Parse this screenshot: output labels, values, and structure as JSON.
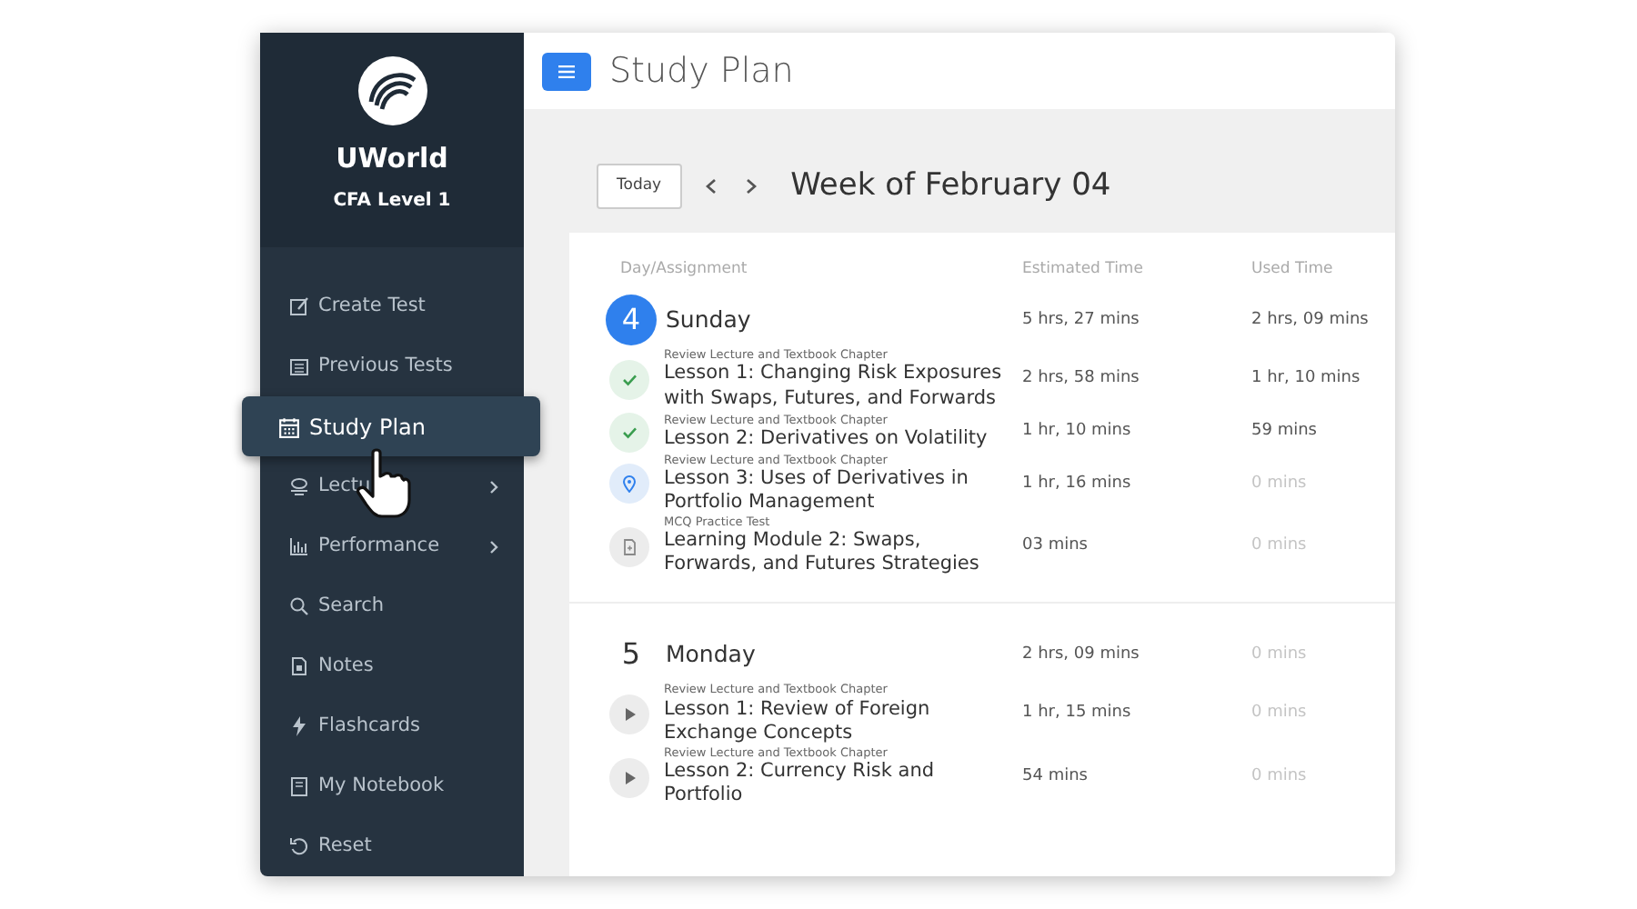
{
  "sidebar": {
    "brand": "UWorld",
    "subtitle": "CFA Level 1",
    "items": [
      {
        "label": "Create Test",
        "selected": false,
        "submenu": false
      },
      {
        "label": "Previous Tests",
        "selected": false,
        "submenu": false
      },
      {
        "label": "Study Plan",
        "selected": true,
        "submenu": false
      },
      {
        "label": "Lectu",
        "selected": false,
        "submenu": true
      },
      {
        "label": "Performance",
        "selected": false,
        "submenu": true
      },
      {
        "label": "Search",
        "selected": false,
        "submenu": false
      },
      {
        "label": "Notes",
        "selected": false,
        "submenu": false
      },
      {
        "label": "Flashcards",
        "selected": false,
        "submenu": false
      },
      {
        "label": "My Notebook",
        "selected": false,
        "submenu": false
      },
      {
        "label": "Reset",
        "selected": false,
        "submenu": false
      }
    ]
  },
  "header": {
    "title": "Study Plan"
  },
  "toolbar": {
    "today_button": "Today",
    "week_title": "Week of February 04"
  },
  "table": {
    "columns": [
      "Day/Assignment",
      "Estimated Time",
      "Used Time"
    ],
    "days": [
      {
        "number": "4",
        "name": "Sunday",
        "today": true,
        "estimated": "5 hrs, 27 mins",
        "used": "2 hrs, 09 mins",
        "started": true,
        "assignments": [
          {
            "kind": "done",
            "category": "Review Lecture and Textbook Chapter",
            "title": "Lesson 1: Changing Risk Exposures with Swaps, Futures, and Forwards",
            "estimated": "2 hrs, 58 mins",
            "used": "1 hr, 10 mins",
            "started": true
          },
          {
            "kind": "done",
            "category": "Review Lecture and Textbook Chapter",
            "title": "Lesson 2: Derivatives on Volatility",
            "estimated": "1 hr, 10 mins",
            "used": "59 mins",
            "started": true
          },
          {
            "kind": "current",
            "category": "Review Lecture and Textbook Chapter",
            "title": "Lesson 3: Uses of Derivatives in Portfolio Management",
            "estimated": "1 hr, 16 mins",
            "used": "0 mins",
            "started": false
          },
          {
            "kind": "test",
            "category": "MCQ Practice Test",
            "title": "Learning Module 2: Swaps, Forwards, and Futures Strategies",
            "estimated": "03 mins",
            "used": "0 mins",
            "started": false
          }
        ]
      },
      {
        "number": "5",
        "name": "Monday",
        "today": false,
        "estimated": "2 hrs, 09 mins",
        "used": "0 mins",
        "started": false,
        "assignments": [
          {
            "kind": "video",
            "category": "Review Lecture and Textbook Chapter",
            "title": "Lesson 1: Review of Foreign Exchange Concepts",
            "estimated": "1 hr, 15 mins",
            "used": "0 mins",
            "started": false
          },
          {
            "kind": "video",
            "category": "Review Lecture and Textbook Chapter",
            "title": "Lesson 2: Currency Risk and Portfolio",
            "estimated": "54 mins",
            "used": "0 mins",
            "started": false
          }
        ]
      }
    ]
  }
}
